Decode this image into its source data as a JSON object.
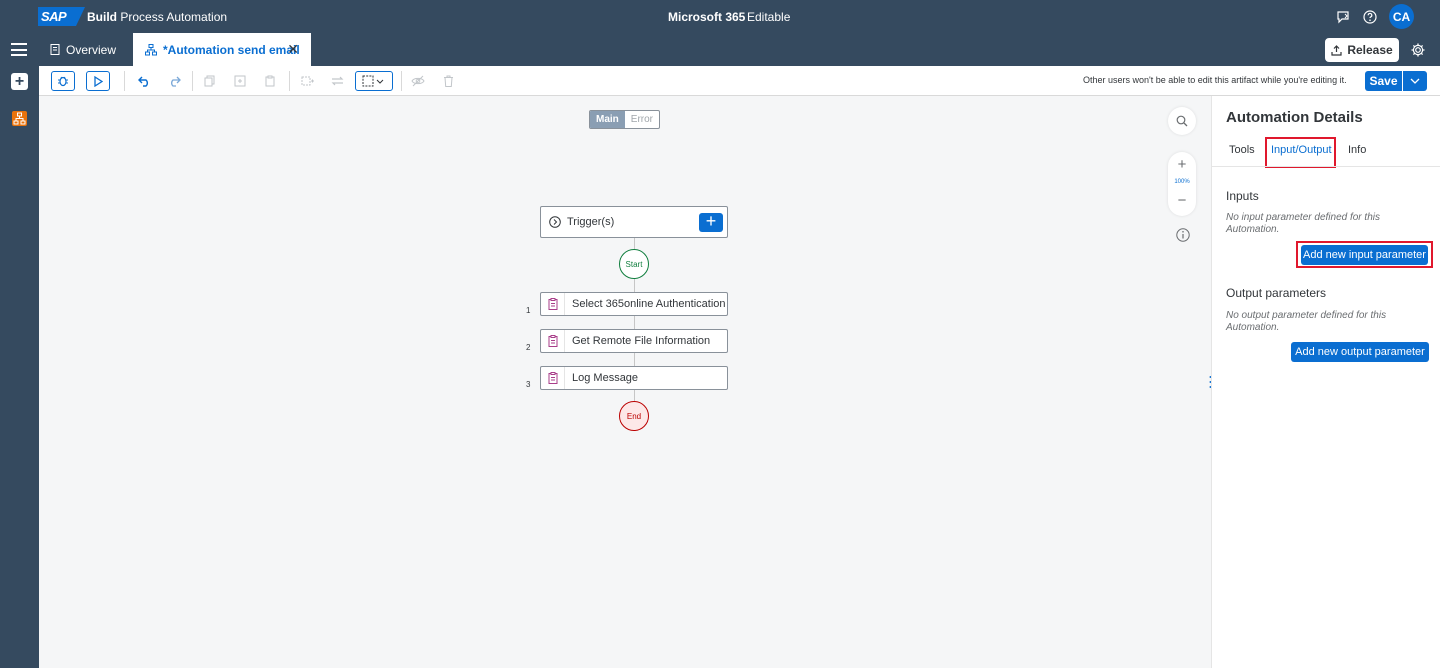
{
  "shellbar": {
    "logo_text": "SAP",
    "app_title_bold": "Build",
    "app_title_rest": "Process Automation",
    "project_name": "Microsoft 365",
    "project_status": "Editable",
    "avatar_initials": "CA",
    "icons": [
      "feedback-icon",
      "help-icon"
    ]
  },
  "tabs": {
    "overview_label": "Overview",
    "active_label": "*Automation send email"
  },
  "header_actions": {
    "release_label": "Release"
  },
  "toolbar": {
    "lock_note": "Other users won't be able to edit this artifact while you're editing it.",
    "save_label": "Save"
  },
  "canvas": {
    "mode_main": "Main",
    "mode_error": "Error",
    "trigger_label": "Trigger(s)",
    "start_label": "Start",
    "end_label": "End",
    "steps": [
      {
        "num": "1",
        "label": "Select 365online Authentication"
      },
      {
        "num": "2",
        "label": "Get Remote File Information"
      },
      {
        "num": "3",
        "label": "Log Message"
      }
    ],
    "zoom_level": "100%"
  },
  "panel": {
    "title": "Automation Details",
    "tabs": [
      "Tools",
      "Input/Output",
      "Info"
    ],
    "selected_tab": "Input/Output",
    "inputs_title": "Inputs",
    "inputs_note": "No input parameter defined for this Automation.",
    "add_input_label": "Add new input parameter",
    "outputs_title": "Output parameters",
    "outputs_note": "No output parameter defined for this Automation.",
    "add_output_label": "Add new output parameter"
  },
  "colors": {
    "shell": "#354a5f",
    "accent": "#0a6ed1",
    "highlight": "#e0182d",
    "start": "#107e3e",
    "end": "#bb0000"
  }
}
